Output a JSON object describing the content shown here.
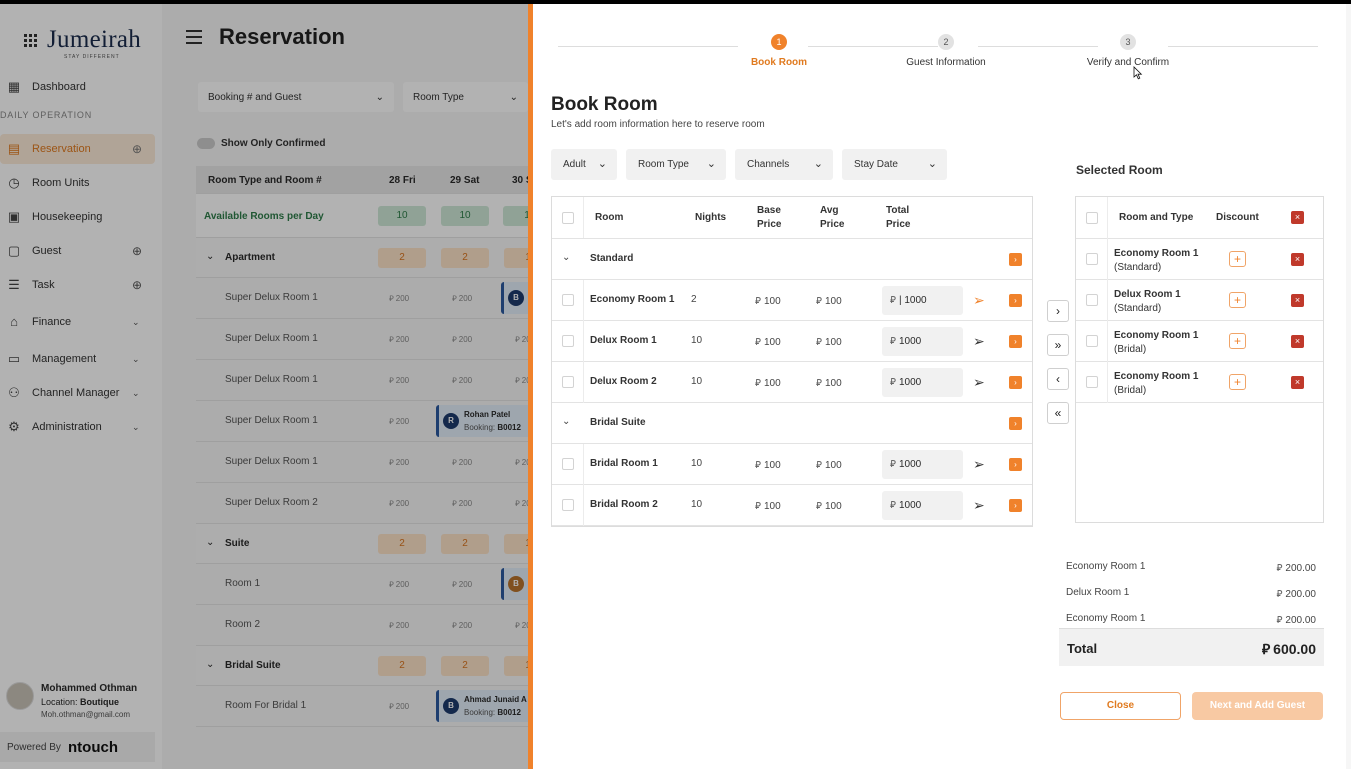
{
  "app": {
    "logo": "Jumeirah",
    "logo_tagline": "STAY DIFFERENT",
    "page_title": "Reservation",
    "section_label": "DAILY OPERATION",
    "nav": [
      {
        "label": "Dashboard"
      },
      {
        "label": "Reservation"
      },
      {
        "label": "Room Units"
      },
      {
        "label": "Housekeeping"
      },
      {
        "label": "Guest"
      },
      {
        "label": "Task"
      },
      {
        "label": "Finance"
      },
      {
        "label": "Management"
      },
      {
        "label": "Channel Manager"
      },
      {
        "label": "Administration"
      }
    ],
    "user": {
      "name": "Mohammed Othman",
      "location_label": "Location:",
      "location": "Boutique",
      "email": "Moh.othman@gmail.com"
    },
    "powered_by": "Powered By",
    "brand": "ntouch",
    "filters": {
      "booking": "Booking # and Guest",
      "room_type": "Room Type"
    },
    "toggle_label": "Show Only Confirmed",
    "grid": {
      "header": {
        "room": "Room Type  and Room #",
        "d1": "28 Fri",
        "d2": "29 Sat",
        "d3": "30 S"
      },
      "available_label": "Available Rooms per Day",
      "available": [
        "10",
        "10",
        "1"
      ],
      "groups": [
        {
          "name": "Apartment",
          "counts": [
            "2",
            "2",
            "1"
          ]
        },
        {
          "name": "Suite",
          "counts": [
            "2",
            "2",
            "1"
          ]
        },
        {
          "name": "Bridal Suite",
          "counts": [
            "2",
            "2",
            "1"
          ]
        }
      ],
      "rooms": [
        "Super Delux Room 1",
        "Super Delux Room 1",
        "Super Delux Room 1",
        "Super Delux Room 1",
        "Super Delux Room 1",
        "Super Delux Room 2",
        "Room 1",
        "Room 2",
        "Room For Bridal 1"
      ],
      "price": "200",
      "bookings": [
        {
          "initial": "B",
          "name": "",
          "sub": ""
        },
        {
          "initial": "R",
          "name": "Rohan Patel",
          "sub_label": "Booking:",
          "sub": "B0012"
        },
        {
          "initial": "B",
          "name": "Ahmad Junaid A",
          "sub_label": "Booking:",
          "sub": "B0012"
        }
      ]
    }
  },
  "drawer": {
    "steps": [
      {
        "num": "1",
        "label": "Book Room"
      },
      {
        "num": "2",
        "label": "Guest Information"
      },
      {
        "num": "3",
        "label": "Verify and Confirm"
      }
    ],
    "title": "Book Room",
    "subtitle": "Let's add room information here to reserve room",
    "filters": {
      "adult": "Adult",
      "room_type": "Room Type",
      "channels": "Channels",
      "stay_date": "Stay Date"
    },
    "table": {
      "headers": {
        "room": "Room",
        "nights": "Nights",
        "base": "Base\nPrice",
        "avg": "Avg\nPrice",
        "total": "Total\nPrice"
      },
      "currency": "⃁",
      "groups": [
        {
          "name": "Standard",
          "rooms": [
            {
              "name": "Economy Room 1",
              "nights": "2",
              "base": "100",
              "avg": "100",
              "total": "| 1000"
            },
            {
              "name": "Delux Room 1",
              "nights": "10",
              "base": "100",
              "avg": "100",
              "total": "1000"
            },
            {
              "name": "Delux Room 2",
              "nights": "10",
              "base": "100",
              "avg": "100",
              "total": "1000"
            }
          ]
        },
        {
          "name": "Bridal Suite",
          "rooms": [
            {
              "name": "Bridal Room 1",
              "nights": "10",
              "base": "100",
              "avg": "100",
              "total": "1000"
            },
            {
              "name": "Bridal Room 2",
              "nights": "10",
              "base": "100",
              "avg": "100",
              "total": "1000"
            }
          ]
        }
      ]
    },
    "selected": {
      "title": "Selected Room",
      "headers": {
        "room": "Room and Type",
        "discount": "Discount"
      },
      "rows": [
        {
          "name": "Economy Room 1",
          "type": "(Standard)"
        },
        {
          "name": "Delux Room 1",
          "type": "(Standard)"
        },
        {
          "name": "Economy Room 1",
          "type": "(Bridal)"
        },
        {
          "name": "Economy Room 1",
          "type": "(Bridal)"
        }
      ]
    },
    "summary": [
      {
        "label": "Economy Room 1",
        "value": "200.00"
      },
      {
        "label": "Delux Room 1",
        "value": "200.00"
      },
      {
        "label": "Economy Room 1",
        "value": "200.00"
      }
    ],
    "total_label": "Total",
    "total_value": "600.00",
    "close_label": "Close",
    "next_label": "Next and Add Guest"
  },
  "colors": {
    "accent": "#f0822b",
    "danger": "#c0392b",
    "available": "#cfe9d7"
  }
}
